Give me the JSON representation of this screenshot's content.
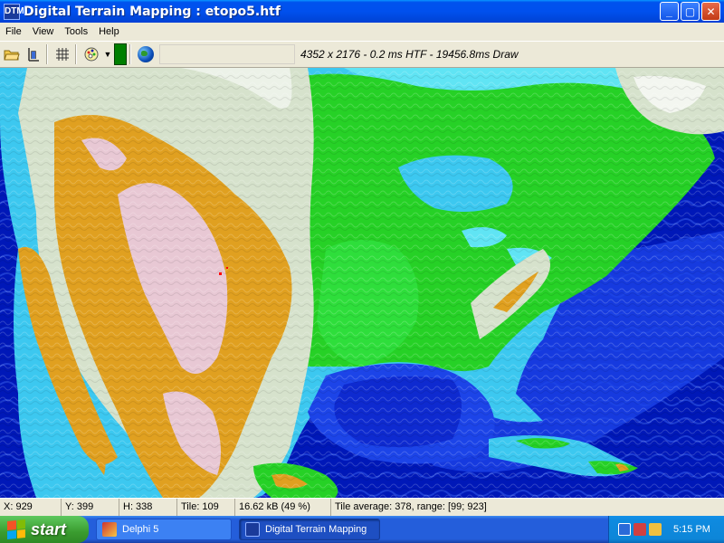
{
  "window": {
    "title": "Digital Terrain Mapping : etopo5.htf",
    "app_icon_text": "DTM"
  },
  "caption_buttons": {
    "minimize": "_",
    "maximize": "▢",
    "close": "✕"
  },
  "menu": [
    "File",
    "View",
    "Tools",
    "Help"
  ],
  "toolbar": {
    "info": "4352 x 2176 - 0.2 ms HTF - 19456.8ms Draw",
    "color_swatch": "#007f00"
  },
  "status": {
    "x": "X: 929",
    "y": "Y: 399",
    "h": "H: 338",
    "tile": "Tile: 109",
    "size": "16.62 kB (49 %)",
    "tile_average": "Tile average: 378, range: [99; 923]"
  },
  "taskbar": {
    "start": "start",
    "tasks": [
      {
        "label": "Delphi 5",
        "active": false
      },
      {
        "label": "Digital Terrain Mapping",
        "active": true
      }
    ],
    "clock": "5:15 PM"
  },
  "colors": {
    "deep_ocean": "#0018b8",
    "ocean": "#1c44e8",
    "shelf": "#3cc8f0",
    "shelf_light": "#60e4f4",
    "lowland": "#26d126",
    "highland": "#d6e2cc",
    "mountain": "#e0a020",
    "peak": "#e8c8d4"
  }
}
